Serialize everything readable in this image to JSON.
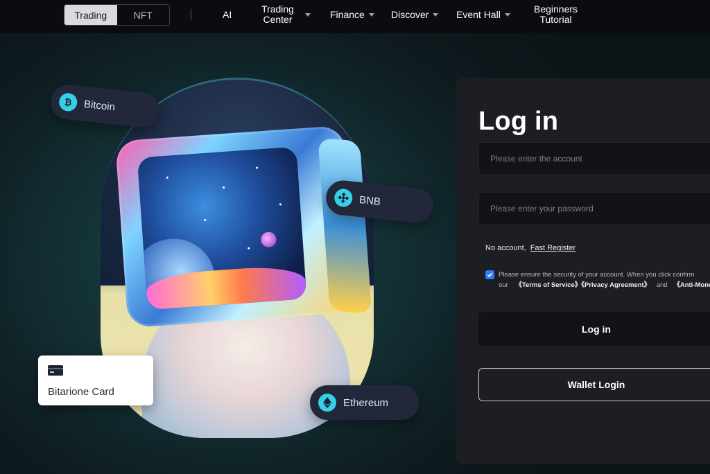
{
  "nav": {
    "segment": {
      "trading": "Trading",
      "nft": "NFT"
    },
    "items": {
      "ai": "AI",
      "trading_center_line1": "Trading",
      "trading_center_line2": "Center",
      "finance": "Finance",
      "discover": "Discover",
      "event_hall": "Event Hall",
      "beginners_line1": "Beginners",
      "beginners_line2": "Tutorial"
    }
  },
  "hero": {
    "pills": {
      "bitcoin": "Bitcoin",
      "bnb": "BNB",
      "ethereum": "Ethereum"
    },
    "card_label": "Bitarione Card"
  },
  "login": {
    "title": "Log in",
    "account_placeholder": "Please enter the account",
    "password_placeholder": "Please enter your password",
    "no_account": "No account,",
    "fast_register": "Fast Register",
    "agree_line1": "Please ensure the security of your account. When you click confirm",
    "agree_line2_prefix": "our",
    "terms": "《Terms of Service》",
    "privacy": "《Privacy Agreement》",
    "and": "and",
    "aml": "《Anti-Money L",
    "agree_checked": true,
    "login_button": "Log in",
    "wallet_button": "Wallet Login"
  },
  "colors": {
    "accent_blue": "#2d7bf5",
    "coin_cyan": "#35d0e6",
    "panel_bg": "#1d1e23",
    "nav_bg": "#0b0c0f"
  }
}
